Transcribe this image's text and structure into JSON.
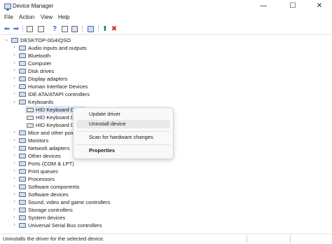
{
  "window": {
    "title": "Device Manager",
    "controls": {
      "minimize": "—",
      "maximize": "☐",
      "close": "✕"
    }
  },
  "menu": [
    "File",
    "Action",
    "View",
    "Help"
  ],
  "toolbar": {
    "icons": [
      "back-icon",
      "forward-icon",
      "properties-icon",
      "list-icon",
      "help-icon",
      "view-icon",
      "update-driver-icon",
      "scan-icon",
      "add-driver-icon",
      "uninstall-icon"
    ],
    "glyphs": {
      "back": "⬅",
      "forward": "➡",
      "help": "?",
      "add": "⬆",
      "remove": "✖"
    },
    "colors": {
      "arrow": "#3a7bd5",
      "help": "#2d6bc4",
      "remove": "#d32f2f",
      "add": "#2e7d32"
    }
  },
  "tree": {
    "root": "DESKTOP-0G4IQSO",
    "categories": [
      {
        "label": "Audio inputs and outputs",
        "icon": "speaker-icon"
      },
      {
        "label": "Bluetooth",
        "icon": "bluetooth-icon"
      },
      {
        "label": "Computer",
        "icon": "computer-icon"
      },
      {
        "label": "Disk drives",
        "icon": "disk-icon"
      },
      {
        "label": "Display adapters",
        "icon": "display-icon"
      },
      {
        "label": "Human Interface Devices",
        "icon": "hid-icon"
      },
      {
        "label": "IDE ATA/ATAPI controllers",
        "icon": "ide-icon"
      },
      {
        "label": "Keyboards",
        "icon": "keyboard-icon",
        "expanded": true,
        "children": [
          "HID Keyboard Device",
          "HID Keyboard De",
          "HID Keyboard De"
        ]
      },
      {
        "label": "Mice and other pointing devices",
        "icon": "mouse-icon"
      },
      {
        "label": "Monitors",
        "icon": "monitor-icon"
      },
      {
        "label": "Network adapters",
        "icon": "network-icon"
      },
      {
        "label": "Other devices",
        "icon": "unknown-device-icon"
      },
      {
        "label": "Ports (COM & LPT)",
        "icon": "port-icon"
      },
      {
        "label": "Print queues",
        "icon": "printer-icon"
      },
      {
        "label": "Processors",
        "icon": "processor-icon"
      },
      {
        "label": "Software components",
        "icon": "component-icon"
      },
      {
        "label": "Software devices",
        "icon": "software-icon"
      },
      {
        "label": "Sound, video and game controllers",
        "icon": "sound-icon"
      },
      {
        "label": "Storage controllers",
        "icon": "storage-icon"
      },
      {
        "label": "System devices",
        "icon": "system-icon"
      },
      {
        "label": "Universal Serial Bus controllers",
        "icon": "usb-icon"
      }
    ],
    "glyphs": {
      "expanded": "⌄",
      "collapsed": "›"
    },
    "colors": {
      "selection": "#dbe8f7",
      "icon_fill": "#cfdff2",
      "icon_border": "#5a6b80"
    }
  },
  "context_menu": {
    "items": [
      "Update driver",
      "Uninstall device",
      "Scan for hardware changes",
      "Properties"
    ],
    "hovered": "Uninstall device"
  },
  "status": {
    "text": "Uninstalls the driver for the selected device."
  }
}
